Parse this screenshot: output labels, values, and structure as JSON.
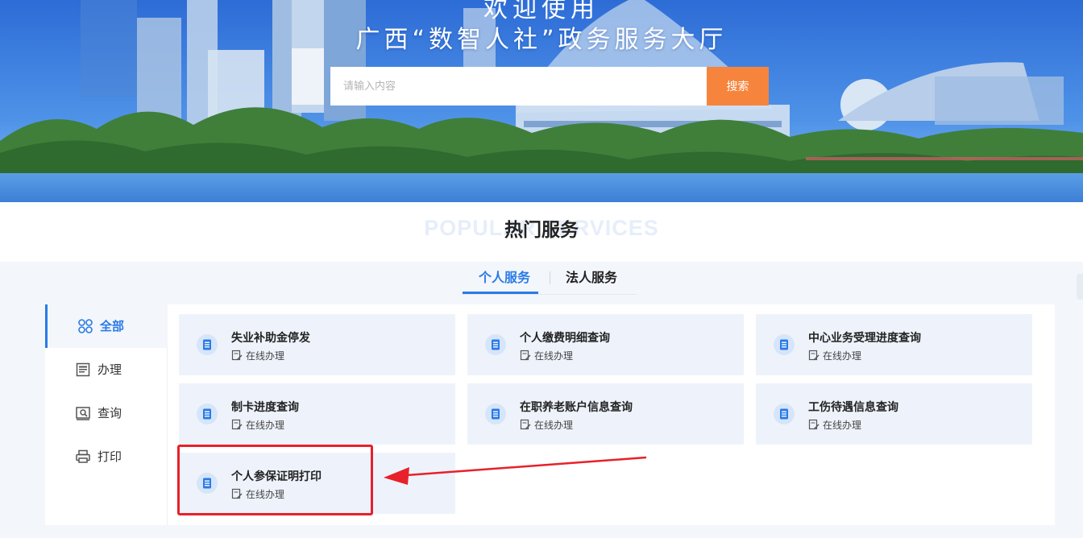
{
  "banner": {
    "title_line1": "欢迎使用",
    "title_line2": "广西“数智人社”政务服务大厅"
  },
  "search": {
    "placeholder": "请输入内容",
    "button_label": "搜索"
  },
  "section": {
    "title": "热门服务",
    "bg_text": "POPULAR SERVICES"
  },
  "tabs": [
    {
      "label": "个人服务",
      "active": true
    },
    {
      "label": "法人服务",
      "active": false
    }
  ],
  "sidebar": {
    "items": [
      {
        "label": "全部",
        "icon": "grid-icon",
        "active": true
      },
      {
        "label": "办理",
        "icon": "document-icon",
        "active": false
      },
      {
        "label": "查询",
        "icon": "search-doc-icon",
        "active": false
      },
      {
        "label": "打印",
        "icon": "printer-icon",
        "active": false
      }
    ]
  },
  "services": [
    {
      "title": "失业补助金停发",
      "subtitle": "在线办理"
    },
    {
      "title": "个人缴费明细查询",
      "subtitle": "在线办理"
    },
    {
      "title": "中心业务受理进度查询",
      "subtitle": "在线办理"
    },
    {
      "title": "制卡进度查询",
      "subtitle": "在线办理"
    },
    {
      "title": "在职养老账户信息查询",
      "subtitle": "在线办理"
    },
    {
      "title": "工伤待遇信息查询",
      "subtitle": "在线办理"
    },
    {
      "title": "个人参保证明打印",
      "subtitle": "在线办理"
    }
  ],
  "colors": {
    "accent": "#2a7be6",
    "search_button": "#f7843c",
    "highlight": "#e8202a"
  }
}
